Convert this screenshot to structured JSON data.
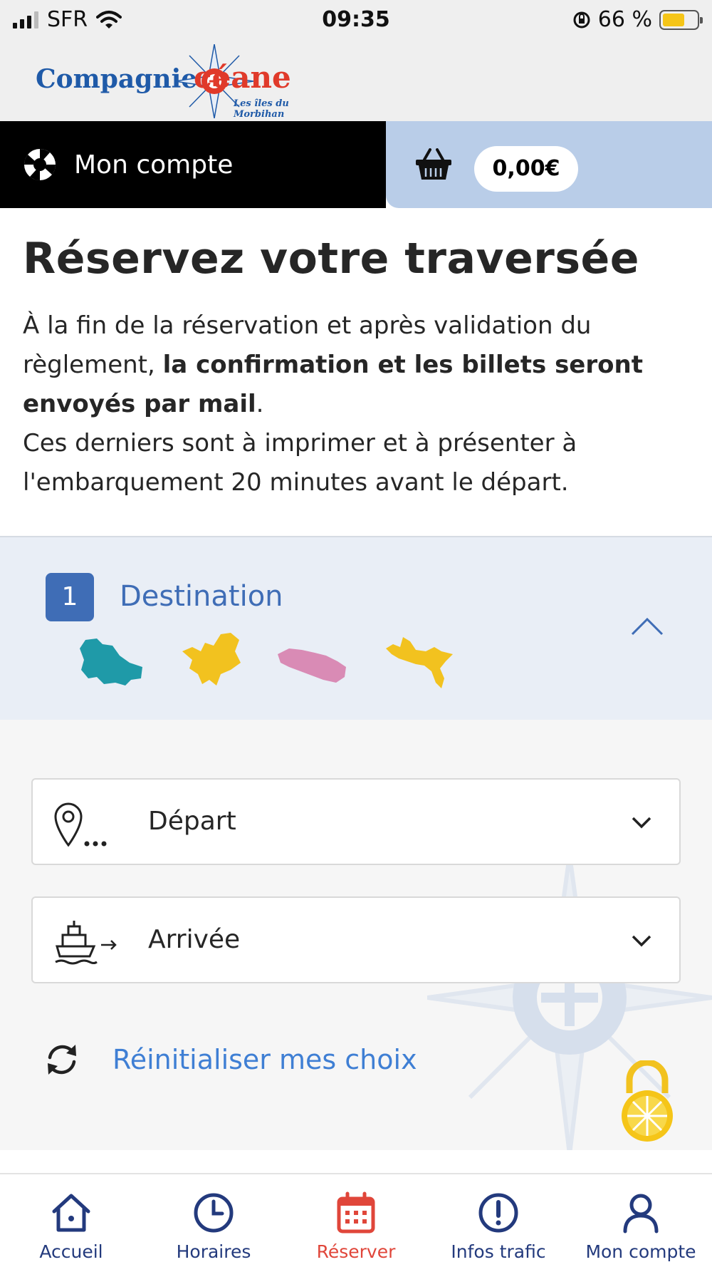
{
  "status_bar": {
    "carrier": "SFR",
    "time": "09:35",
    "battery_percent": "66 %",
    "battery_level": 0.66
  },
  "logo": {
    "word1": "Compagnie",
    "word2": "céane",
    "tagline": "Les îles du Morbihan"
  },
  "account_bar": {
    "account_label": "Mon compte",
    "basket_total": "0,00€"
  },
  "page": {
    "title": "Réservez votre traversée",
    "intro_part1": "À la fin de la réservation et après validation du règlement, ",
    "intro_bold": "la confirmation et les billets seront envoyés par mail",
    "intro_part2": ".",
    "intro_part3": "Ces derniers sont à imprimer et à présenter à l'embarquement 20 minutes avant le départ."
  },
  "destination": {
    "step_number": "1",
    "step_label": "Destination",
    "island_colors": [
      "#1f9aa8",
      "#f2c21f",
      "#d98bb5",
      "#f2c21f"
    ]
  },
  "form": {
    "departure_label": "Départ",
    "arrival_label": "Arrivée",
    "reset_label": "Réinitialiser mes choix"
  },
  "bottom_nav": {
    "items": [
      {
        "label": "Accueil",
        "icon": "home-icon"
      },
      {
        "label": "Horaires",
        "icon": "clock-icon"
      },
      {
        "label": "Réserver",
        "icon": "calendar-icon"
      },
      {
        "label": "Infos trafic",
        "icon": "alert-icon"
      },
      {
        "label": "Mon compte",
        "icon": "user-icon"
      }
    ],
    "active_index": 2
  },
  "colors": {
    "brand_blue": "#3f6db6",
    "link_blue": "#3f7fd4",
    "nav_blue": "#233a7d",
    "active_red": "#e0463a",
    "basket_bg": "#b9cde8"
  }
}
